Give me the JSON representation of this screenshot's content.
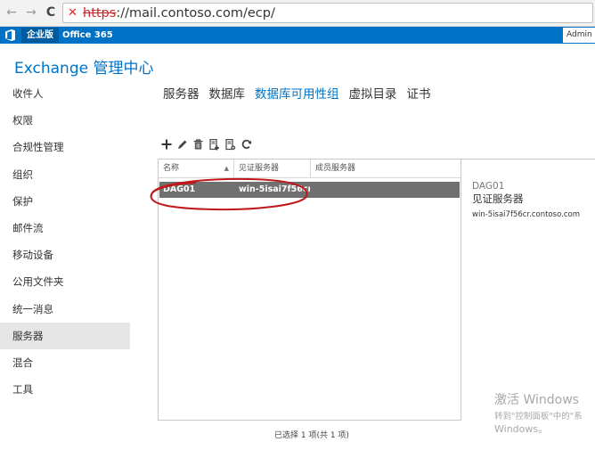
{
  "browser": {
    "back_glyph": "←",
    "forward_glyph": "→",
    "reload_glyph": "C",
    "warn_glyph": "✕",
    "url_scheme": "https",
    "url_rest": "://mail.contoso.com/ecp/"
  },
  "suite": {
    "brand_label": "企业版",
    "office_label": "Office 365",
    "admin_label": "Admin"
  },
  "app": {
    "title": "Exchange 管理中心"
  },
  "leftnav": {
    "items": [
      {
        "label": "收件人"
      },
      {
        "label": "权限"
      },
      {
        "label": "合规性管理"
      },
      {
        "label": "组织"
      },
      {
        "label": "保护"
      },
      {
        "label": "邮件流"
      },
      {
        "label": "移动设备"
      },
      {
        "label": "公用文件夹"
      },
      {
        "label": "统一消息"
      },
      {
        "label": "服务器"
      },
      {
        "label": "混合"
      },
      {
        "label": "工具"
      }
    ],
    "active_index": 9
  },
  "tabs": {
    "items": [
      {
        "label": "服务器"
      },
      {
        "label": "数据库"
      },
      {
        "label": "数据库可用性组"
      },
      {
        "label": "虚拟目录"
      },
      {
        "label": "证书"
      }
    ],
    "active_index": 2
  },
  "toolbar": {
    "icons": [
      "add-icon",
      "edit-icon",
      "delete-icon",
      "manage-membership-icon",
      "network-settings-icon",
      "refresh-icon"
    ]
  },
  "table": {
    "columns": [
      {
        "label": "名称"
      },
      {
        "label": "见证服务器"
      },
      {
        "label": "成员服务器"
      }
    ],
    "sort_glyph": "▲",
    "rows": [
      {
        "name": "DAG01",
        "witness": "win-5isai7f56cr.c...",
        "members": ""
      }
    ]
  },
  "details": {
    "name": "DAG01",
    "heading": "见证服务器",
    "value": "win-5isai7f56cr.contoso.com"
  },
  "status": {
    "text": "已选择 1 项(共 1 项)"
  },
  "watermark": {
    "title": "激活 Windows",
    "line1": "转到\"控制面板\"中的\"系",
    "line2": "Windows。"
  },
  "colors": {
    "accent": "#0072c6",
    "suite_bar": "#0072c6",
    "selected_row": "#707070",
    "annotation": "#c0171b"
  }
}
